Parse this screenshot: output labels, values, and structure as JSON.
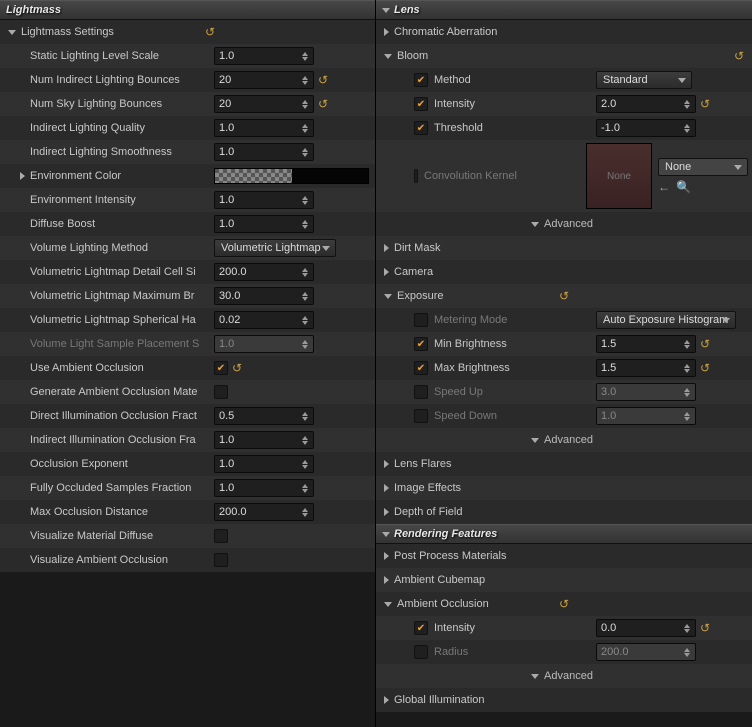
{
  "left": {
    "title": "Lightmass",
    "settingsHeader": "Lightmass Settings",
    "rows": {
      "staticScale": {
        "label": "Static Lighting Level Scale",
        "value": "1.0"
      },
      "numIndirect": {
        "label": "Num Indirect Lighting Bounces",
        "value": "20"
      },
      "numSky": {
        "label": "Num Sky Lighting Bounces",
        "value": "20"
      },
      "indirectQuality": {
        "label": "Indirect Lighting Quality",
        "value": "1.0"
      },
      "indirectSmooth": {
        "label": "Indirect Lighting Smoothness",
        "value": "1.0"
      },
      "envColor": {
        "label": "Environment Color"
      },
      "envIntensity": {
        "label": "Environment Intensity",
        "value": "1.0"
      },
      "diffuseBoost": {
        "label": "Diffuse Boost",
        "value": "1.0"
      },
      "volMethod": {
        "label": "Volume Lighting Method",
        "value": "Volumetric Lightmap"
      },
      "volDetail": {
        "label": "Volumetric Lightmap Detail Cell Si",
        "value": "200.0"
      },
      "volMaxBr": {
        "label": "Volumetric Lightmap Maximum Br",
        "value": "30.0"
      },
      "volSph": {
        "label": "Volumetric Lightmap Spherical Ha",
        "value": "0.02"
      },
      "volSample": {
        "label": "Volume Light Sample Placement S",
        "value": "1.0"
      },
      "useAO": {
        "label": "Use Ambient Occlusion"
      },
      "genAO": {
        "label": "Generate Ambient Occlusion Mate"
      },
      "directOcc": {
        "label": "Direct Illumination Occlusion Fract",
        "value": "0.5"
      },
      "indirectOcc": {
        "label": "Indirect Illumination Occlusion Fra",
        "value": "1.0"
      },
      "occExp": {
        "label": "Occlusion Exponent",
        "value": "1.0"
      },
      "fullyOcc": {
        "label": "Fully Occluded Samples Fraction",
        "value": "1.0"
      },
      "maxOccDist": {
        "label": "Max Occlusion Distance",
        "value": "200.0"
      },
      "visDiffuse": {
        "label": "Visualize Material Diffuse"
      },
      "visAO": {
        "label": "Visualize Ambient Occlusion"
      }
    }
  },
  "right": {
    "lensTitle": "Lens",
    "chromatic": "Chromatic Aberration",
    "bloom": {
      "header": "Bloom",
      "method": {
        "label": "Method",
        "value": "Standard"
      },
      "intensity": {
        "label": "Intensity",
        "value": "2.0"
      },
      "threshold": {
        "label": "Threshold",
        "value": "-1.0"
      },
      "convKernel": {
        "label": "Convolution Kernel",
        "asset": "None",
        "thumb": "None"
      }
    },
    "advanced": "Advanced",
    "dirtMask": "Dirt Mask",
    "camera": "Camera",
    "exposure": {
      "header": "Exposure",
      "metering": {
        "label": "Metering Mode",
        "value": "Auto Exposure Histogram"
      },
      "minBr": {
        "label": "Min Brightness",
        "value": "1.5"
      },
      "maxBr": {
        "label": "Max Brightness",
        "value": "1.5"
      },
      "speedUp": {
        "label": "Speed Up",
        "value": "3.0"
      },
      "speedDown": {
        "label": "Speed Down",
        "value": "1.0"
      }
    },
    "lensFlares": "Lens Flares",
    "imageEffects": "Image Effects",
    "dof": "Depth of Field",
    "renderingTitle": "Rendering Features",
    "ppm": "Post Process Materials",
    "ambCubemap": "Ambient Cubemap",
    "ao": {
      "header": "Ambient Occlusion",
      "intensity": {
        "label": "Intensity",
        "value": "0.0"
      },
      "radius": {
        "label": "Radius",
        "value": "200.0"
      }
    },
    "globalIllum": "Global Illumination"
  }
}
